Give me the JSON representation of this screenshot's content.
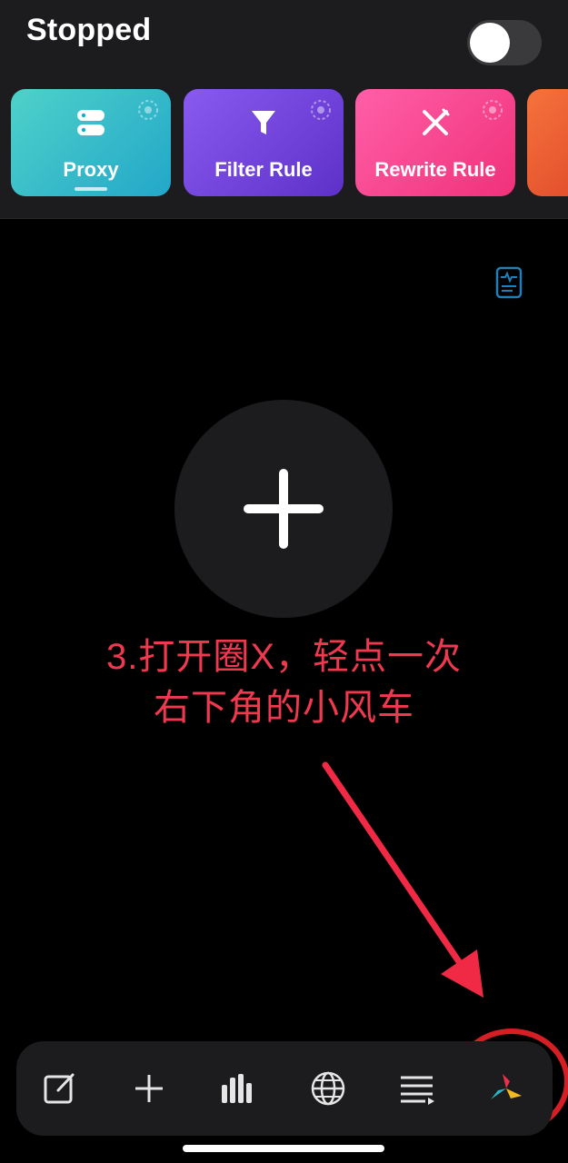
{
  "status": {
    "title": "Stopped",
    "toggle_on": false
  },
  "cards": [
    {
      "label": "Proxy",
      "icon": "server-stack-icon",
      "selected": true
    },
    {
      "label": "Filter Rule",
      "icon": "filter-icon",
      "selected": false
    },
    {
      "label": "Rewrite Rule",
      "icon": "crossed-pencil-icon",
      "selected": false
    }
  ],
  "colors": {
    "proxy": "#22a7c9",
    "filter": "#6a3de0",
    "rewrite": "#f53f86",
    "annotation": "#f0394f",
    "background": "#000000"
  },
  "annotation": {
    "line1": "3.打开圈X，轻点一次",
    "line2": "右下角的小风车"
  },
  "tabbar": {
    "items": [
      "edit-icon",
      "add-icon",
      "stats-icon",
      "globe-icon",
      "list-icon",
      "pinwheel-icon"
    ],
    "highlighted": "pinwheel-icon"
  }
}
